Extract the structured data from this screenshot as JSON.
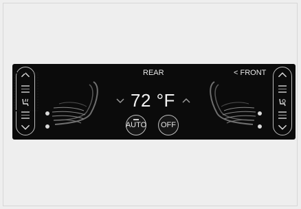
{
  "panel": {
    "rear_label": "REAR",
    "front_label": "< FRONT",
    "temperature": "72 °F",
    "auto_label": "AUTO",
    "off_label": "OFF"
  },
  "colors": {
    "panel_bg": "#0b0b0b",
    "text": "#e9e9e9",
    "highlight_box": "#111111"
  },
  "icons": {
    "left_column": [
      "chevron-up-icon",
      "level-bars-icon",
      "seat-heat-icon",
      "level-bars-icon",
      "chevron-down-icon"
    ],
    "right_column": [
      "chevron-up-icon",
      "level-bars-icon",
      "seat-fan-icon",
      "level-bars-icon",
      "chevron-down-icon"
    ]
  }
}
